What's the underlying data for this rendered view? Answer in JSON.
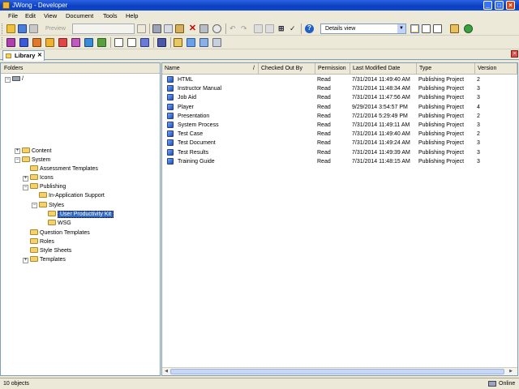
{
  "window": {
    "title": "JWong - Developer"
  },
  "menu": [
    "File",
    "Edit",
    "View",
    "Document",
    "Tools",
    "Help"
  ],
  "toolbar": {
    "preview_label": "Preview",
    "view_select": "Details view"
  },
  "tab": {
    "label": "Library",
    "close": "✕"
  },
  "folders": {
    "header": "Folders",
    "nodes": [
      "/",
      "Content",
      "System",
      "Assessment Templates",
      "Icons",
      "Publishing",
      "In-Application Support",
      "Styles",
      "User Productivity Kit",
      "WSG",
      "Question Templates",
      "Roles",
      "Style Sheets",
      "Templates"
    ]
  },
  "list": {
    "columns": [
      "Name",
      "Checked Out By",
      "Permission",
      "Last Modified Date",
      "Type",
      "Version"
    ],
    "rows": [
      [
        "HTML",
        "",
        "Read",
        "7/31/2014 11:49:40 AM",
        "Publishing Project",
        "2"
      ],
      [
        "Instructor Manual",
        "",
        "Read",
        "7/31/2014 11:48:34 AM",
        "Publishing Project",
        "3"
      ],
      [
        "Job Aid",
        "",
        "Read",
        "7/31/2014 11:47:56 AM",
        "Publishing Project",
        "3"
      ],
      [
        "Player",
        "",
        "Read",
        "9/29/2014 3:54:57 PM",
        "Publishing Project",
        "4"
      ],
      [
        "Presentation",
        "",
        "Read",
        "7/21/2014 5:29:49 PM",
        "Publishing Project",
        "2"
      ],
      [
        "System Process",
        "",
        "Read",
        "7/31/2014 11:49:11 AM",
        "Publishing Project",
        "3"
      ],
      [
        "Test Case",
        "",
        "Read",
        "7/31/2014 11:49:40 AM",
        "Publishing Project",
        "2"
      ],
      [
        "Test Document",
        "",
        "Read",
        "7/31/2014 11:49:24 AM",
        "Publishing Project",
        "3"
      ],
      [
        "Test Results",
        "",
        "Read",
        "7/31/2014 11:49:39 AM",
        "Publishing Project",
        "3"
      ],
      [
        "Training Guide",
        "",
        "Read",
        "7/31/2014 11:48:15 AM",
        "Publishing Project",
        "3"
      ]
    ]
  },
  "status": {
    "count": "10 objects",
    "mode": "Online"
  },
  "colors": {
    "titlebar": "#0a3fc0",
    "selection": "#316ac5",
    "folder": "#f4d26a"
  }
}
